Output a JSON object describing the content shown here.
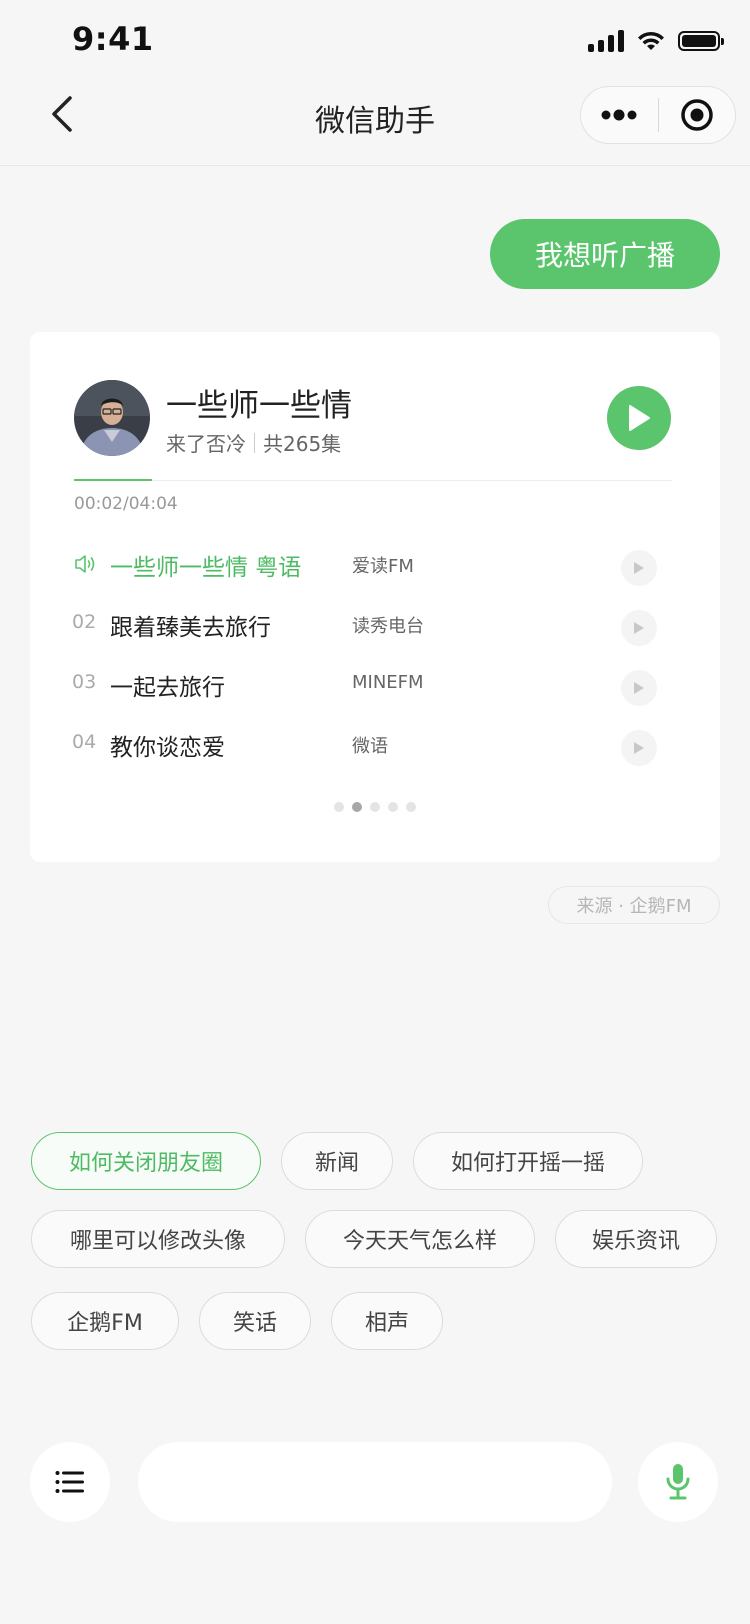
{
  "status_bar": {
    "time": "9:41"
  },
  "nav": {
    "title": "微信助手"
  },
  "user_message": "我想听广播",
  "album": {
    "title": "一些师一些情",
    "author": "来了否冷",
    "episodes": "共265集",
    "progress_fraction": 0.13,
    "time": "00:02/04:04"
  },
  "tracks": [
    {
      "num": "",
      "title": "一些师一些情 粤语",
      "source": "爱读FM",
      "playing": true
    },
    {
      "num": "02",
      "title": "跟着臻美去旅行",
      "source": "读秀电台",
      "playing": false
    },
    {
      "num": "03",
      "title": "一起去旅行",
      "source": "MINEFM",
      "playing": false
    },
    {
      "num": "04",
      "title": "教你谈恋爱",
      "source": "微语",
      "playing": false
    }
  ],
  "pager": {
    "count": 5,
    "current": 2
  },
  "source_label": "来源 · 企鹅FM",
  "suggestions": [
    "如何关闭朋友圈",
    "新闻",
    "如何打开摇一摇",
    "哪里可以修改头像",
    "今天天气怎么样",
    "娱乐资讯",
    "企鹅FM",
    "笑话",
    "相声"
  ],
  "colors": {
    "accent": "#5ac56c",
    "background": "#f6f6f6"
  },
  "icons": {
    "back": "chevron-left-icon",
    "more": "more-dots-icon",
    "close_mini": "target-circle-icon",
    "menu": "list-menu-icon",
    "mic": "microphone-icon",
    "speaker": "speaker-icon",
    "play": "play-icon"
  }
}
